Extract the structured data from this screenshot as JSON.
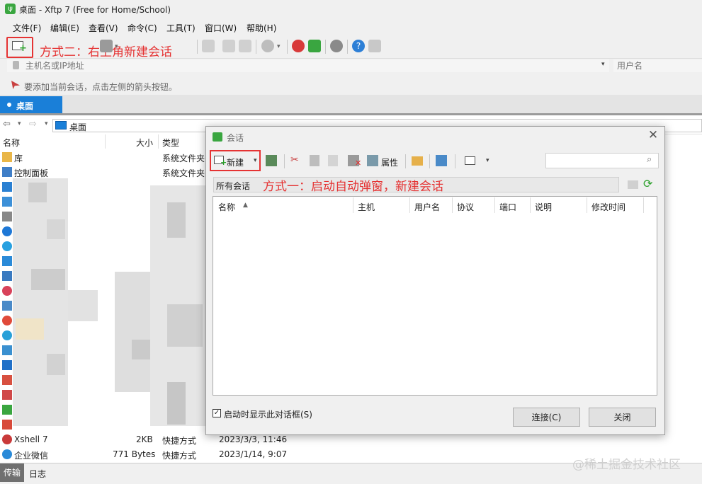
{
  "window": {
    "title": "桌面 - Xftp 7 (Free for Home/School)",
    "app_icon_glyph": "ψ"
  },
  "menu": [
    "文件(F)",
    "编辑(E)",
    "查看(V)",
    "命令(C)",
    "工具(T)",
    "窗口(W)",
    "帮助(H)"
  ],
  "annotations": {
    "top": "方式二：右上角新建会话",
    "dialog": "方式一：启动自动弹窗，新建会话"
  },
  "address": {
    "host_placeholder": "主机名或IP地址",
    "user_placeholder": "用户名"
  },
  "hint": "要添加当前会话，点击左侧的箭头按钮。",
  "tabs": [
    "桌面"
  ],
  "nav": {
    "path": "桌面"
  },
  "filelist": {
    "columns": [
      "名称",
      "大小",
      "类型"
    ],
    "rows": [
      {
        "name": "库",
        "size": "",
        "type": "系统文件夹",
        "date": ""
      },
      {
        "name": "控制面板",
        "size": "",
        "type": "系统文件夹",
        "date": ""
      }
    ],
    "bottom_rows": [
      {
        "name": "Xshell 7",
        "size": "2KB",
        "type": "快捷方式",
        "date": "2023/3/3, 11:46"
      },
      {
        "name": "企业微信",
        "size": "771 Bytes",
        "type": "快捷方式",
        "date": "2023/1/14, 9:07"
      }
    ]
  },
  "bottom_tabs": [
    "传输",
    "日志"
  ],
  "watermark": "@稀土掘金技术社区",
  "dialog": {
    "title": "会话",
    "close_glyph": "✕",
    "toolbar": {
      "new_label": "新建",
      "props_label": "属性"
    },
    "folder": "所有会话",
    "columns": [
      "名称",
      "主机",
      "用户名",
      "协议",
      "端口",
      "说明",
      "修改时间"
    ],
    "checkbox_label": "启动时显示此对话框(S)",
    "checkbox_checked": true,
    "connect_label": "连接(C)",
    "close_label": "关闭"
  },
  "colors": {
    "accent": "#1a7fd8",
    "annotation": "#e53333",
    "app_green": "#3aa640"
  }
}
